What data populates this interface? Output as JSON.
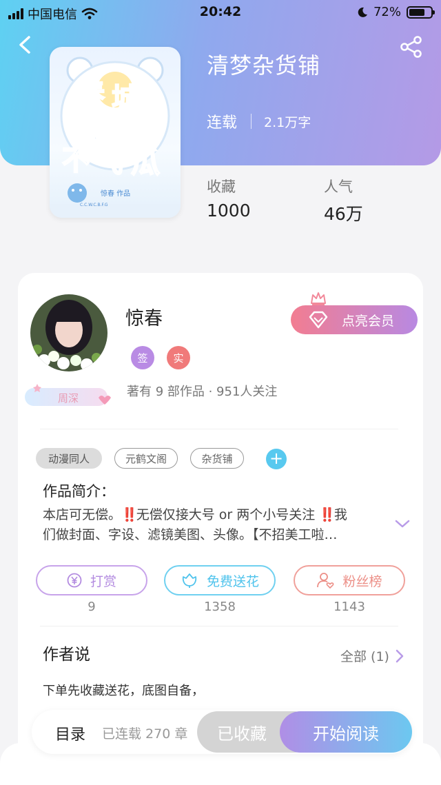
{
  "status_bar": {
    "carrier": "中国电信",
    "time": "20:42",
    "battery": "72%"
  },
  "book": {
    "title": "清梦杂货铺",
    "status": "连载",
    "word_count": "2.1万字"
  },
  "stats": [
    {
      "label": "收藏",
      "value": "1000"
    },
    {
      "label": "人气",
      "value": "46万"
    }
  ],
  "cover_art": {
    "title_text": "春城无处不飞瓜",
    "byline": "惊春 作品",
    "sub": "C.C.W.C.B.F.G"
  },
  "author": {
    "name": "惊春",
    "badge_sign": "签",
    "badge_real": "实",
    "tag": "周深",
    "stats_text": "著有 9 部作品 · 951人关注"
  },
  "vip_button": "点亮会员",
  "chips": [
    "动漫同人",
    "元鹤文阁",
    "杂货铺"
  ],
  "intro": {
    "title": "作品简介：",
    "line1_a": "本店可无偿。",
    "bang": "‼️",
    "line1_b": "无偿仅接大号 or 两个小号关注 ",
    "line1_c": "我",
    "line2": "们做封面、字设、滤镜美图、头像。【不招美工啦…"
  },
  "actions": [
    {
      "label": "打赏",
      "count": "9",
      "icon": "yuan-coin-icon"
    },
    {
      "label": "免费送花",
      "count": "1358",
      "icon": "flower-icon"
    },
    {
      "label": "粉丝榜",
      "count": "1143",
      "icon": "fans-icon"
    }
  ],
  "author_say": {
    "title": "作者说",
    "all": "全部 (1)",
    "text": "下单先收藏送花，底图自备，"
  },
  "bottom": {
    "toc": "目录",
    "toc_count": "已连载 270 章",
    "collected": "已收藏",
    "read": "开始阅读"
  },
  "colors": {
    "hero_start": "#5ed1f2",
    "hero_end": "#b49ae6",
    "accent_purple": "#b38be0",
    "accent_blue": "#4fc3ec",
    "accent_red": "#ec8f87"
  }
}
